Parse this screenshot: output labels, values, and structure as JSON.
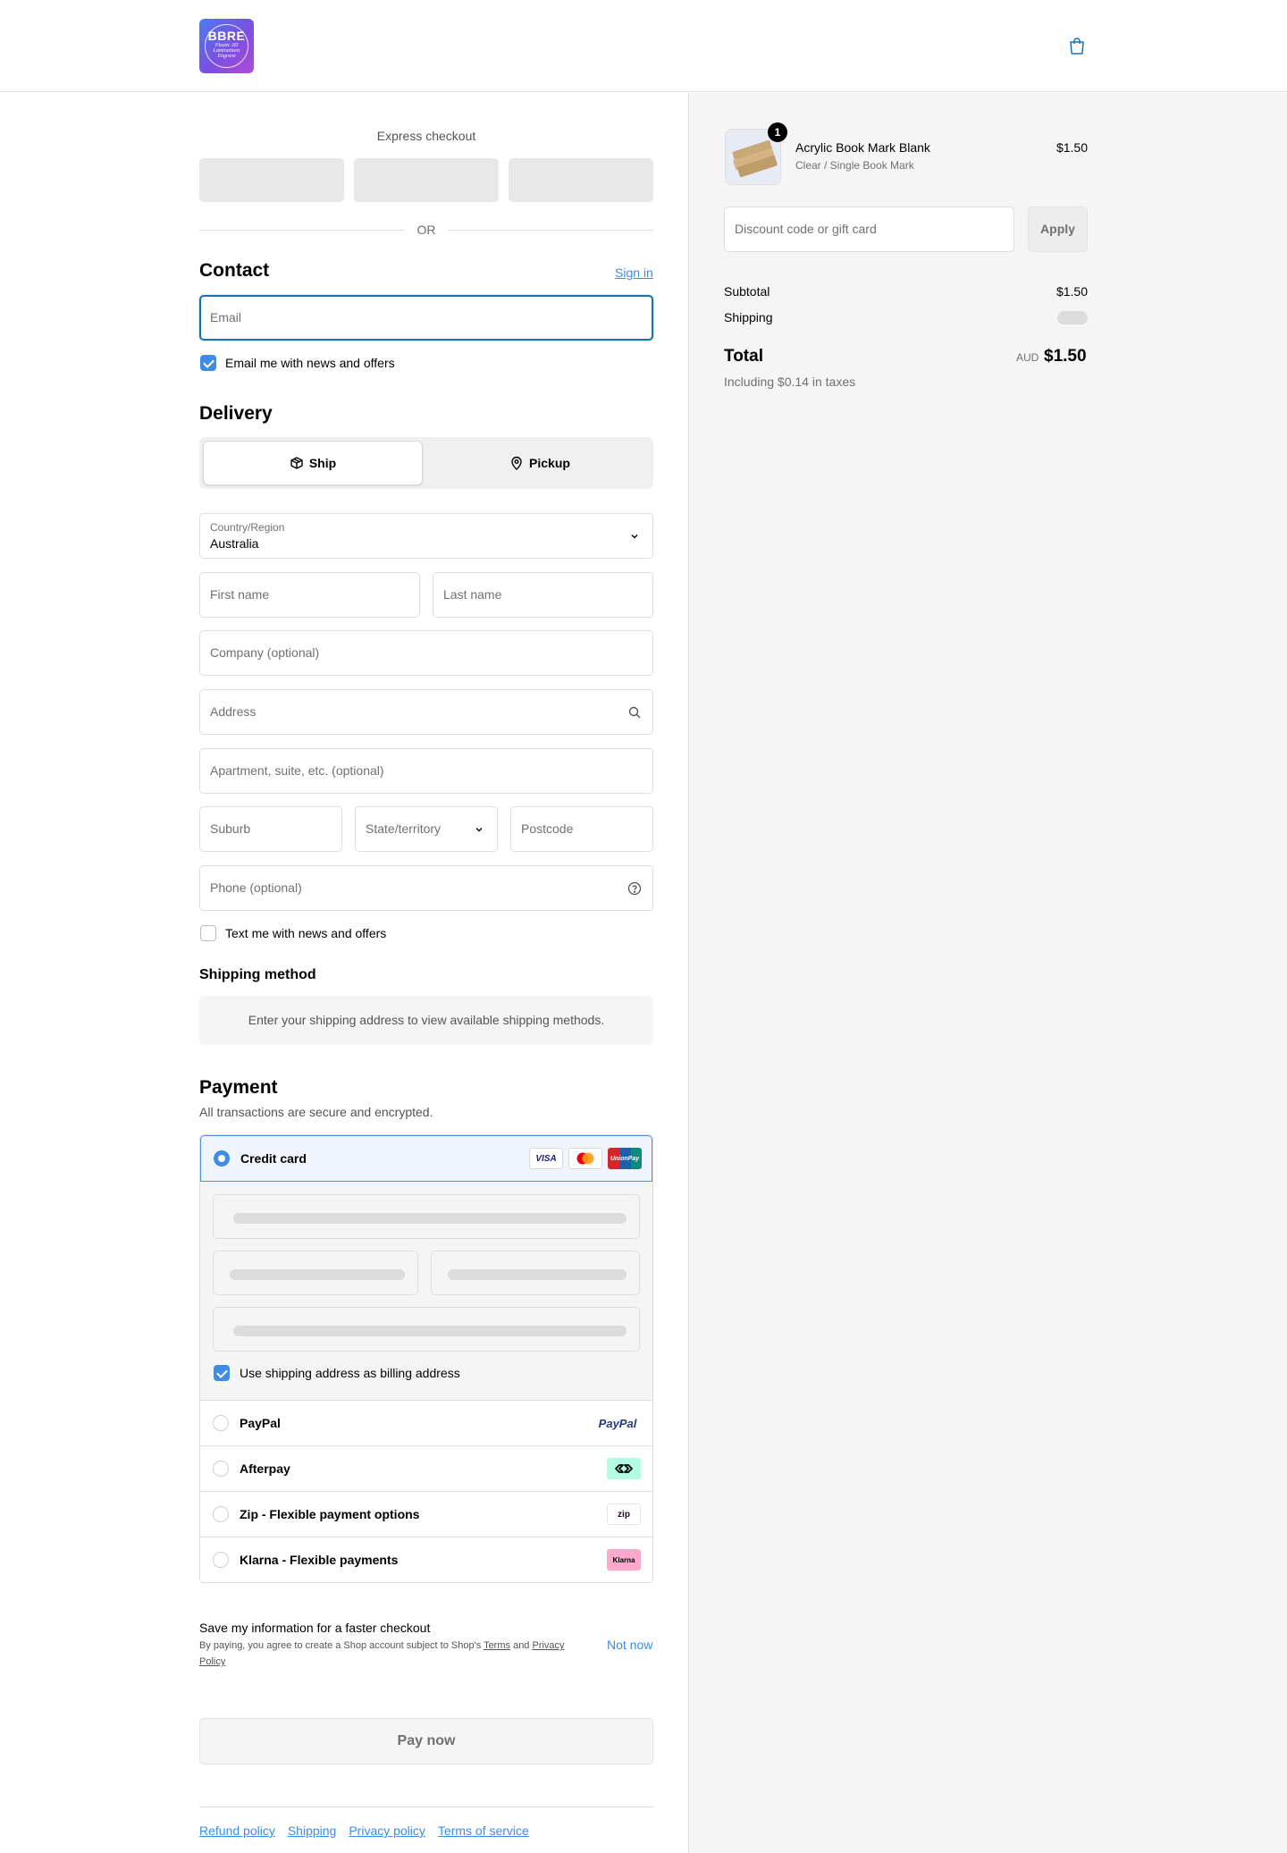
{
  "header": {
    "logo_text": "BBRE",
    "logo_subtext": "Plastic 3D Laminations Engrave"
  },
  "express": {
    "title": "Express checkout",
    "or_label": "OR"
  },
  "contact": {
    "title": "Contact",
    "sign_in": "Sign in",
    "email_placeholder": "Email",
    "news_label": "Email me with news and offers",
    "news_checked": true
  },
  "delivery": {
    "title": "Delivery",
    "tabs": [
      {
        "label": "Ship",
        "icon": "box-icon",
        "active": true
      },
      {
        "label": "Pickup",
        "icon": "location-pin-icon",
        "active": false
      }
    ],
    "country_label": "Country/Region",
    "country_value": "Australia",
    "first_name_placeholder": "First name",
    "last_name_placeholder": "Last name",
    "company_placeholder": "Company (optional)",
    "address_placeholder": "Address",
    "apartment_placeholder": "Apartment, suite, etc. (optional)",
    "suburb_placeholder": "Suburb",
    "state_placeholder": "State/territory",
    "postcode_placeholder": "Postcode",
    "phone_placeholder": "Phone (optional)",
    "text_news_label": "Text me with news and offers",
    "text_news_checked": false
  },
  "shipping_method": {
    "title": "Shipping method",
    "info": "Enter your shipping address to view available shipping methods."
  },
  "payment": {
    "title": "Payment",
    "subtitle": "All transactions are secure and encrypted.",
    "credit_card_label": "Credit card",
    "card_brands": [
      "VISA",
      "Mastercard",
      "UnionPay"
    ],
    "billing_label": "Use shipping address as billing address",
    "billing_checked": true,
    "methods": [
      {
        "label": "PayPal",
        "brand": "PayPal"
      },
      {
        "label": "Afterpay",
        "brand": "afterpay-icon"
      },
      {
        "label": "Zip - Flexible payment options",
        "brand": "zip"
      },
      {
        "label": "Klarna - Flexible payments",
        "brand": "Klarna"
      }
    ]
  },
  "save_info": {
    "title": "Save my information for a faster checkout",
    "desc_prefix": "By paying, you agree to create a Shop account subject to Shop's ",
    "terms": "Terms",
    "and": " and ",
    "privacy": "Privacy Policy",
    "not_now": "Not now"
  },
  "pay_now": "Pay now",
  "footer": {
    "links": [
      "Refund policy",
      "Shipping",
      "Privacy policy",
      "Terms of service"
    ]
  },
  "order": {
    "item": {
      "quantity": "1",
      "name": "Acrylic Book Mark Blank",
      "variant": "Clear / Single Book Mark",
      "price": "$1.50"
    },
    "discount_placeholder": "Discount code or gift card",
    "apply_label": "Apply",
    "subtotal_label": "Subtotal",
    "subtotal_value": "$1.50",
    "shipping_label": "Shipping",
    "total_label": "Total",
    "total_currency": "AUD",
    "total_value": "$1.50",
    "tax_note": "Including $0.14 in taxes"
  },
  "colors": {
    "accent": "#3e8ce4",
    "link": "#1773b0",
    "panel_bg": "#f5f5f5"
  }
}
